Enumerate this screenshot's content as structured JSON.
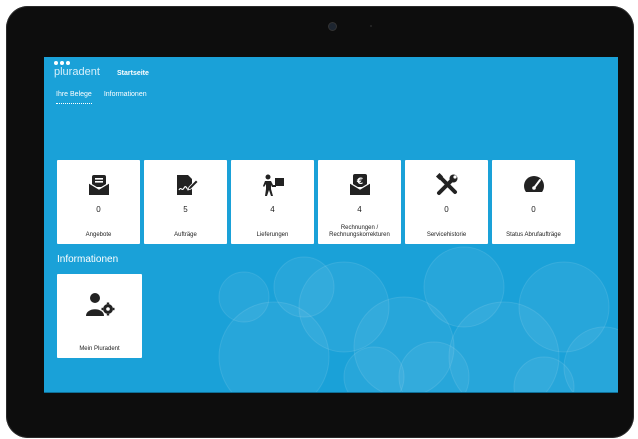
{
  "header": {
    "logo_text": "pluradent",
    "page_title": "Startseite"
  },
  "nav": [
    {
      "label": "Ihre Belege"
    },
    {
      "label": "Informationen"
    }
  ],
  "tiles": [
    {
      "icon": "envelope-document-icon",
      "count": "0",
      "label": "Angebote"
    },
    {
      "icon": "signed-document-icon",
      "count": "5",
      "label": "Aufträge"
    },
    {
      "icon": "delivery-person-icon",
      "count": "4",
      "label": "Lieferungen"
    },
    {
      "icon": "euro-envelope-icon",
      "count": "4",
      "label": "Rechnungen / Rechnungskorrekturen"
    },
    {
      "icon": "tools-icon",
      "count": "0",
      "label": "Servicehistorie"
    },
    {
      "icon": "gauge-icon",
      "count": "0",
      "label": "Status Abrufaufträge"
    }
  ],
  "info_section": {
    "title": "Informationen",
    "tile": {
      "icon": "user-gear-icon",
      "label": "Mein Pluradent"
    }
  },
  "colors": {
    "screen_bg": "#1aa1d8",
    "tile_bg": "#ffffff",
    "bezel": "#0d0d0d"
  }
}
